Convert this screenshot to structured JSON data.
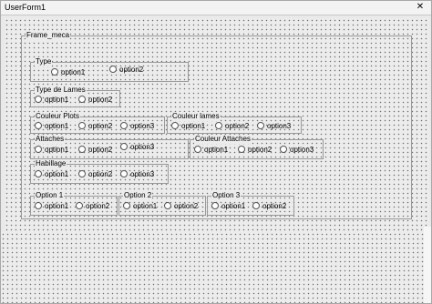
{
  "window": {
    "title": "UserForm1",
    "close_glyph": "✕"
  },
  "frame_meca": {
    "label": "Frame_meca"
  },
  "type": {
    "label": "Type",
    "options": [
      "option1",
      "option2"
    ]
  },
  "type_lames": {
    "label": "Type de Lames",
    "options": [
      "option1",
      "option2"
    ]
  },
  "couleur_plots": {
    "label": "Couleur Plots",
    "options": [
      "option1",
      "option2",
      "option3"
    ]
  },
  "couleur_lames": {
    "label": "Couleur lames",
    "options": [
      "option1",
      "option2",
      "option3"
    ]
  },
  "attaches": {
    "label": "Attaches",
    "options": [
      "option1",
      "option2",
      "option3"
    ]
  },
  "couleur_attaches": {
    "label": "Couleur Attaches",
    "options": [
      "option1",
      "option2",
      "option3"
    ]
  },
  "habillage": {
    "label": "Habillage",
    "options": [
      "option1",
      "option2",
      "option3"
    ]
  },
  "option_1": {
    "label": "Option 1",
    "options": [
      "option1",
      "option2"
    ]
  },
  "option_2": {
    "label": "Option 2",
    "options": [
      "option1",
      "option2"
    ]
  },
  "option_3": {
    "label": "Option 3",
    "options": [
      "option1",
      "option2"
    ]
  }
}
